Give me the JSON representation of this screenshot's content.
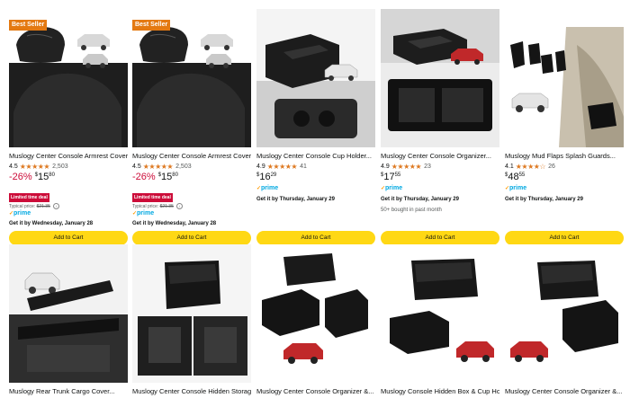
{
  "colors": {
    "badge": "#e47911",
    "discount": "#cc0c39",
    "stars": "#de7921",
    "prime": "#00a8e1",
    "cart_button": "#ffd814"
  },
  "row1": [
    {
      "badge": "Best Seller",
      "title": "Muslogy Center Console Armrest Cover...",
      "rating": "4.5",
      "stars": "★★★★★",
      "reviews": "2,503",
      "discount": "-26%",
      "currency": "$",
      "price_whole": "15",
      "price_frac": "80",
      "deal": "Limited time deal",
      "typical_label": "Typical price:",
      "typical_price": "$21.35",
      "prime": "prime",
      "delivery": "Get it by Wednesday, January 28",
      "cart": "Add to Cart"
    },
    {
      "badge": "Best Seller",
      "title": "Muslogy Center Console Armrest Cover...",
      "rating": "4.5",
      "stars": "★★★★★",
      "reviews": "2,503",
      "discount": "-26%",
      "currency": "$",
      "price_whole": "15",
      "price_frac": "80",
      "deal": "Limited time deal",
      "typical_label": "Typical price:",
      "typical_price": "$21.35",
      "prime": "prime",
      "delivery": "Get it by Wednesday, January 28",
      "cart": "Add to Cart"
    },
    {
      "title": "Muslogy Center Console Cup Holder...",
      "rating": "4.9",
      "stars": "★★★★★",
      "reviews": "41",
      "currency": "$",
      "price_whole": "16",
      "price_frac": "29",
      "prime": "prime",
      "delivery": "Get it by Thursday, January 29",
      "cart": "Add to Cart"
    },
    {
      "title": "Muslogy Center Console Organizer...",
      "rating": "4.9",
      "stars": "★★★★★",
      "reviews": "23",
      "currency": "$",
      "price_whole": "17",
      "price_frac": "55",
      "prime": "prime",
      "delivery": "Get it by Thursday, January 29",
      "bought": "50+ bought in past month",
      "cart": "Add to Cart"
    },
    {
      "title": "Muslogy Mud Flaps Splash Guards...",
      "rating": "4.1",
      "stars": "★★★★☆",
      "reviews": "26",
      "currency": "$",
      "price_whole": "48",
      "price_frac": "55",
      "prime": "prime",
      "delivery": "Get it by Thursday, January 29",
      "cart": "Add to Cart"
    }
  ],
  "row2": [
    {
      "title": "Muslogy Rear Trunk Cargo Cover..."
    },
    {
      "title": "Muslogy Center Console Hidden Storage..."
    },
    {
      "title": "Muslogy Center Console Organizer &..."
    },
    {
      "title": "Muslogy Console Hidden Box & Cup Holder..."
    },
    {
      "title": "Muslogy Center Console Organizer &..."
    }
  ]
}
